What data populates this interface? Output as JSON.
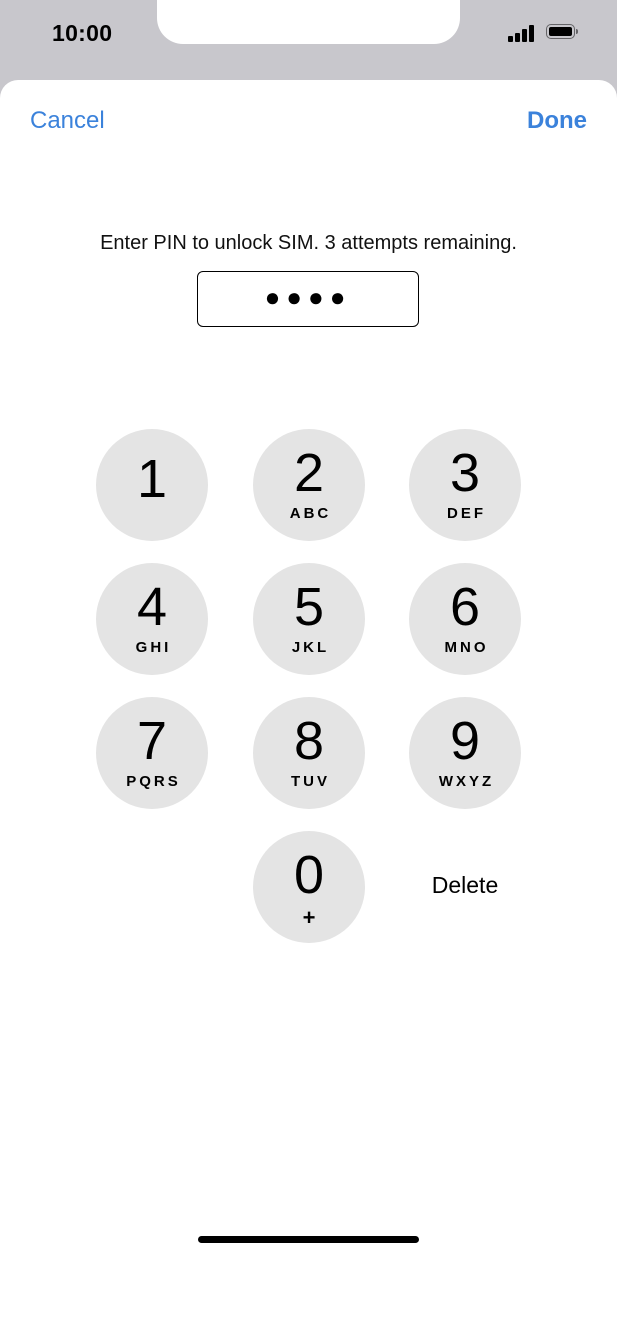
{
  "status_bar": {
    "time": "10:00",
    "signal_icon": "cellular-signal-icon",
    "battery_icon": "battery-icon"
  },
  "nav": {
    "cancel_label": "Cancel",
    "done_label": "Done"
  },
  "prompt": "Enter PIN to unlock SIM. 3 attempts remaining.",
  "pin_field": {
    "value": "●●●●"
  },
  "keypad": {
    "keys": [
      {
        "digit": "1",
        "letters": ""
      },
      {
        "digit": "2",
        "letters": "ABC"
      },
      {
        "digit": "3",
        "letters": "DEF"
      },
      {
        "digit": "4",
        "letters": "GHI"
      },
      {
        "digit": "5",
        "letters": "JKL"
      },
      {
        "digit": "6",
        "letters": "MNO"
      },
      {
        "digit": "7",
        "letters": "PQRS"
      },
      {
        "digit": "8",
        "letters": "TUV"
      },
      {
        "digit": "9",
        "letters": "WXYZ"
      },
      {
        "digit": "0",
        "letters": "+"
      }
    ],
    "delete_label": "Delete"
  },
  "colors": {
    "accent": "#3b82db",
    "key_background": "#e4e4e4",
    "status_background": "#c8c7cc"
  }
}
